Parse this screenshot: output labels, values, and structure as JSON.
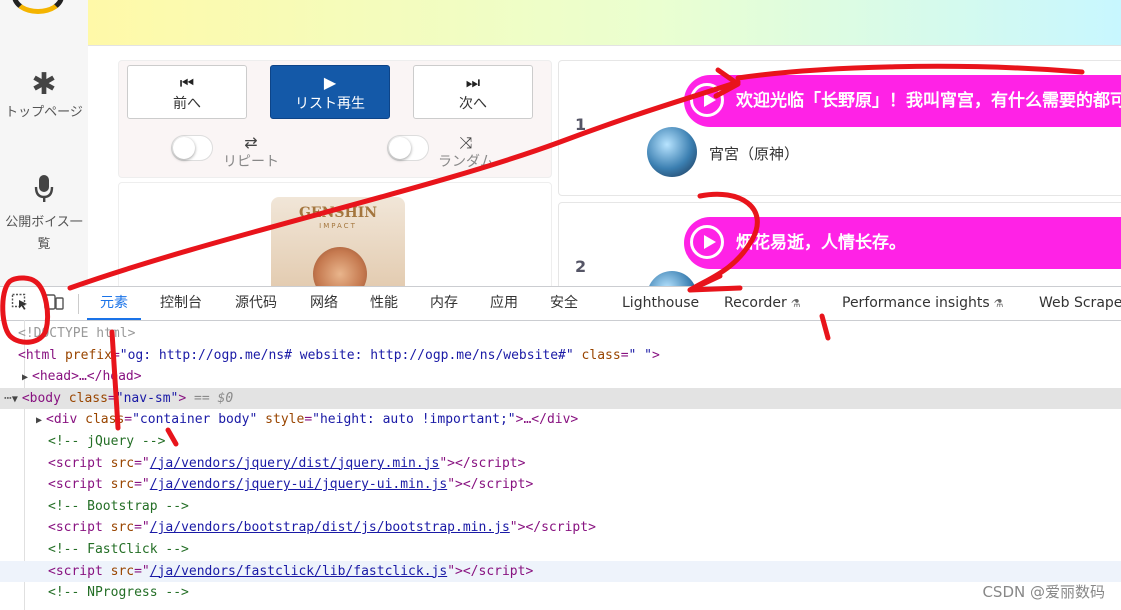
{
  "left_nav": {
    "items": [
      {
        "icon": "asterisk-icon",
        "glyph": "✱",
        "label": "トップページ"
      },
      {
        "icon": "microphone-icon",
        "glyph": "🎙",
        "label": "公開ボイス一覧"
      }
    ]
  },
  "player": {
    "prev_label": "前へ",
    "play_label": "リスト再生",
    "next_label": "次へ",
    "repeat_label": "リピート",
    "random_label": "ランダム"
  },
  "cover": {
    "logo": "GENSHIN",
    "subtitle": "IMPACT"
  },
  "voices": [
    {
      "number": "1",
      "text": "欢迎光临「长野原」！我叫宵宫，有什么需要的都可以和我说",
      "speaker": "宵宮（原神）"
    },
    {
      "number": "2",
      "text": "烟花易逝，人情长存。",
      "speaker": ""
    }
  ],
  "devtools": {
    "tabs": [
      "元素",
      "控制台",
      "源代码",
      "网络",
      "性能",
      "内存",
      "应用",
      "安全",
      "Lighthouse",
      "Recorder",
      "Performance insights",
      "Web Scraper"
    ],
    "active_tab": "元素",
    "dom": {
      "doctype": "<!DOCTYPE html>",
      "html_prefix_attr": "prefix",
      "html_prefix_val": "\"og: http://ogp.me/ns# website: http://ogp.me/ns/website#\"",
      "html_class_val": "\" \"",
      "head_collapsed": "<head>…</head>",
      "body_class_val": "\"nav-sm\"",
      "selected_marker": "== $0",
      "div_class_val": "\"container body\"",
      "div_style_val": "\"height: auto !important;\"",
      "comment_jquery": "<!-- jQuery -->",
      "src_jquery": "/ja/vendors/jquery/dist/jquery.min.js",
      "src_jquery_ui": "/ja/vendors/jquery-ui/jquery-ui.min.js",
      "comment_bootstrap": "<!-- Bootstrap -->",
      "src_bootstrap": "/ja/vendors/bootstrap/dist/js/bootstrap.min.js",
      "comment_fastclick": "<!-- FastClick -->",
      "src_fastclick": "/ja/vendors/fastclick/lib/fastclick.js",
      "comment_nprogress": "<!-- NProgress -->"
    }
  },
  "watermark": "CSDN @爱丽数码",
  "colors": {
    "annotation_red": "#e8141b",
    "bubble_magenta": "#ff22e6",
    "play_button_blue": "#1459a8",
    "devtools_accent": "#1a73e8"
  }
}
